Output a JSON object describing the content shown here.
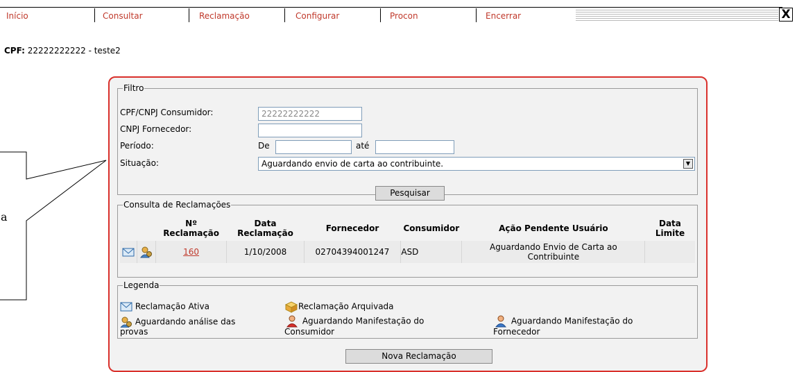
{
  "menu": {
    "items": [
      "Início",
      "Consultar",
      "Reclamação",
      "Configurar",
      "Procon",
      "Encerrar"
    ],
    "close_label": "X"
  },
  "cpf": {
    "label": "CPF:",
    "value": "22222222222 - teste2"
  },
  "callout": {
    "text": "a"
  },
  "filtro": {
    "legend": "Filtro",
    "cpf_cnpj_label": "CPF/CNPJ Consumidor:",
    "cpf_cnpj_value": "22222222222",
    "cnpj_fornecedor_label": "CNPJ Fornecedor:",
    "cnpj_fornecedor_value": "",
    "periodo_label": "Período:",
    "de_label": "De",
    "de_value": "",
    "ate_label": "até",
    "ate_value": "",
    "situacao_label": "Situação:",
    "situacao_value": "Aguardando envio de carta ao contribuinte.",
    "pesquisar_label": "Pesquisar"
  },
  "consulta": {
    "legend": "Consulta de Reclamações",
    "headers": {
      "num_1": "Nº",
      "num_2": "Reclamação",
      "data_1": "Data",
      "data_2": "Reclamação",
      "fornecedor": "Fornecedor",
      "consumidor": "Consumidor",
      "acao": "Ação Pendente Usuário",
      "limite_1": "Data",
      "limite_2": "Limite"
    },
    "rows": [
      {
        "numero": "160",
        "data": "1/10/2008",
        "fornecedor": "02704394001247",
        "consumidor": "ASD",
        "acao_1": "Aguardando Envio de Carta ao",
        "acao_2": "Contribuinte",
        "limite": ""
      }
    ]
  },
  "legenda": {
    "legend": "Legenda",
    "ativa": "Reclamação Ativa",
    "arquivada": "Reclamação Arquivada",
    "provas_1": "Aguardando análise das",
    "provas_2": "provas",
    "consumidor_1": "Aguardando Manifestação do",
    "consumidor_2": "Consumidor",
    "fornecedor_1": "Aguardando Manifestação do",
    "fornecedor_2": "Fornecedor"
  },
  "nova_reclamacao_label": "Nova Reclamação",
  "colors": {
    "accent": "#c0392b",
    "panel_border": "#d9302b",
    "panel_bg": "#f2f2f2"
  }
}
